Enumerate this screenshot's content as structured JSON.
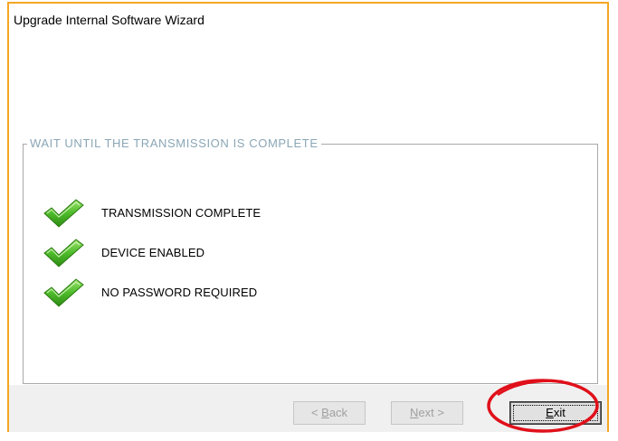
{
  "window": {
    "title": "Upgrade Internal Software Wizard",
    "border_color": "#f5a623"
  },
  "group": {
    "legend": "WAIT UNTIL THE TRANSMISSION IS COMPLETE",
    "legend_color": "#8aa6b6",
    "items": [
      {
        "icon": "green-check-icon",
        "label": "TRANSMISSION COMPLETE"
      },
      {
        "icon": "green-check-icon",
        "label": "DEVICE ENABLED"
      },
      {
        "icon": "green-check-icon",
        "label": "NO PASSWORD REQUIRED"
      }
    ]
  },
  "footer": {
    "back": {
      "mnemonic": "B",
      "rest": "ack",
      "prefix": "< ",
      "enabled": false
    },
    "next": {
      "mnemonic": "N",
      "rest": "ext",
      "suffix": " >",
      "enabled": false
    },
    "exit": {
      "mnemonic": "E",
      "rest": "xit",
      "enabled": true
    }
  },
  "annotation": {
    "highlight_color": "#e0101a"
  }
}
